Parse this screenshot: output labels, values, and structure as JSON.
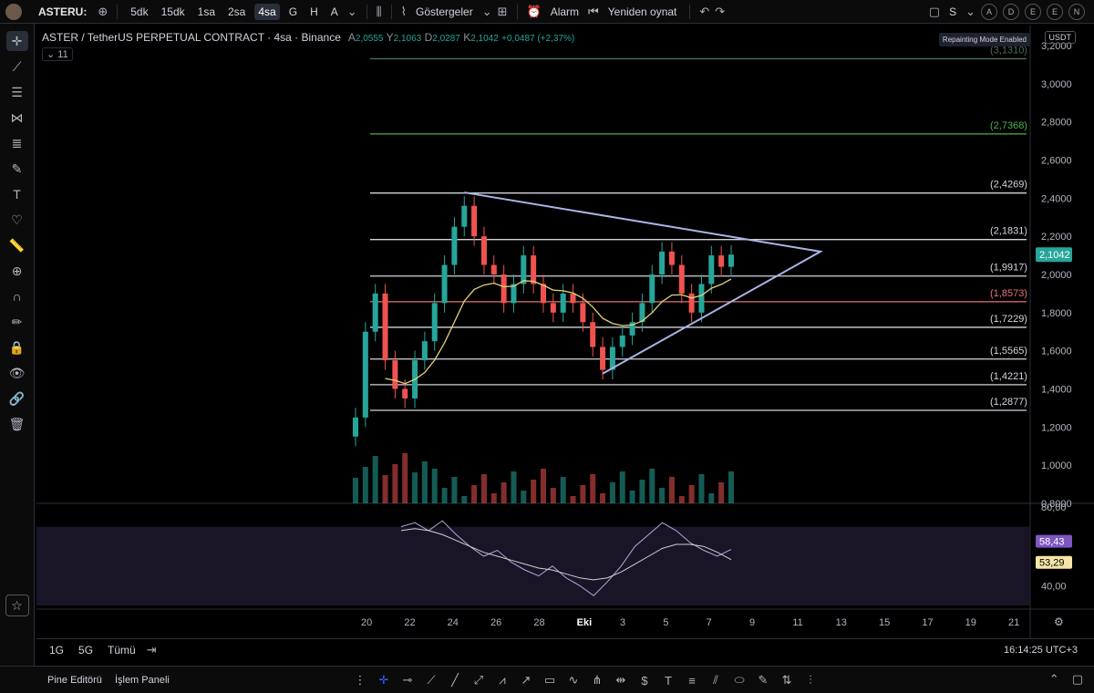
{
  "toolbar": {
    "symbol": "ASTERU:",
    "intervals": [
      "5dk",
      "15dk",
      "1sa",
      "2sa",
      "4sa",
      "G",
      "H",
      "A"
    ],
    "active_interval": "4sa",
    "indicators_label": "Göstergeler",
    "alarm_label": "Alarm",
    "replay_label": "Yeniden oynat",
    "layout_label": "S",
    "account_badges": [
      "A",
      "D",
      "E",
      "E",
      "N"
    ]
  },
  "legend": {
    "title": "ASTER / TetherUS PERPETUAL CONTRACT · 4sa · Binance",
    "open_label": "A",
    "open": "2,0555",
    "high_label": "Y",
    "high": "2,1063",
    "low_label": "D",
    "low": "2,0287",
    "close_label": "K",
    "close": "2,1042",
    "change": "+0,0487 (+2,37%)",
    "indicator_count": "11"
  },
  "badges": {
    "repaint": "Repainting Mode Enabled",
    "currency": "USDT"
  },
  "colors": {
    "up": "#26a69a",
    "down": "#ef5350",
    "triangle": "#aab4e8",
    "ma": "#e3d27a",
    "rsi": "#b0a8e0",
    "rsi_band": "#1a1526"
  },
  "chart_data": [
    {
      "type": "line",
      "title": "",
      "y_axis_ticks": [
        "3,2000",
        "3,0000",
        "2,8000",
        "2,6000",
        "2,4000",
        "2,2000",
        "2,0000",
        "1,8000",
        "1,6000",
        "1,4000",
        "1,2000",
        "1,0000",
        "0,8000"
      ],
      "x_axis_ticks": [
        "20",
        "22",
        "24",
        "26",
        "28",
        "Eki",
        "3",
        "5",
        "7",
        "9",
        "11",
        "13",
        "15",
        "17",
        "19",
        "21"
      ],
      "ylim": [
        0.8,
        3.2
      ],
      "levels": [
        {
          "value": 3.131,
          "label": "(3,1310)",
          "color": "#4a6e5a"
        },
        {
          "value": 2.7368,
          "label": "(2,7368)",
          "color": "#4caf50"
        },
        {
          "value": 2.4269,
          "label": "(2,4269)",
          "color": "#d1d4dc"
        },
        {
          "value": 2.1831,
          "label": "(2,1831)",
          "color": "#d1d4dc"
        },
        {
          "value": 1.9917,
          "label": "(1,9917)",
          "color": "#d1d4dc"
        },
        {
          "value": 1.8573,
          "label": "(1,8573)",
          "color": "#e57373"
        },
        {
          "value": 1.7229,
          "label": "(1,7229)",
          "color": "#d1d4dc"
        },
        {
          "value": 1.5565,
          "label": "(1,5565)",
          "color": "#d1d4dc"
        },
        {
          "value": 1.4221,
          "label": "(1,4221)",
          "color": "#d1d4dc"
        },
        {
          "value": 1.2877,
          "label": "(1,2877)",
          "color": "#d1d4dc"
        }
      ],
      "last_price": "2,1042",
      "series": [
        {
          "values": [
            1.25,
            1.7,
            1.9,
            1.55,
            1.4,
            1.35,
            1.55,
            1.65,
            1.85,
            2.05,
            2.25,
            2.36,
            2.2,
            2.05,
            2.0,
            1.85,
            1.95,
            2.1,
            1.95,
            1.85,
            1.8,
            1.9,
            1.85,
            1.75,
            1.62,
            1.5,
            1.62,
            1.68,
            1.75,
            1.85,
            2.0,
            2.12,
            2.05,
            1.9,
            1.8,
            1.95,
            2.1,
            2.04,
            2.1042
          ]
        }
      ]
    },
    {
      "type": "line",
      "title": "",
      "y_axis_ticks": [
        "80,00",
        "40,00"
      ],
      "ylim": [
        30,
        80
      ],
      "last_values": [
        "58,43",
        "53,29"
      ],
      "series": [
        {
          "values": [
            70,
            72,
            68,
            73,
            66,
            60,
            55,
            58,
            52,
            48,
            45,
            50,
            44,
            40,
            35,
            42,
            50,
            60,
            66,
            72,
            68,
            62,
            58,
            55,
            58.43
          ]
        },
        {
          "values": [
            68,
            69,
            68,
            66,
            63,
            60,
            57,
            55,
            53,
            51,
            49,
            48,
            46,
            44,
            43,
            44,
            47,
            51,
            55,
            59,
            61,
            61,
            60,
            57,
            53.29
          ]
        }
      ]
    }
  ],
  "bottom": {
    "ranges": [
      "1G",
      "5G",
      "Tümü"
    ],
    "clock": "16:14:25 UTC+3"
  },
  "footer": {
    "tabs": [
      "Pine Editörü",
      "İşlem Paneli"
    ]
  }
}
